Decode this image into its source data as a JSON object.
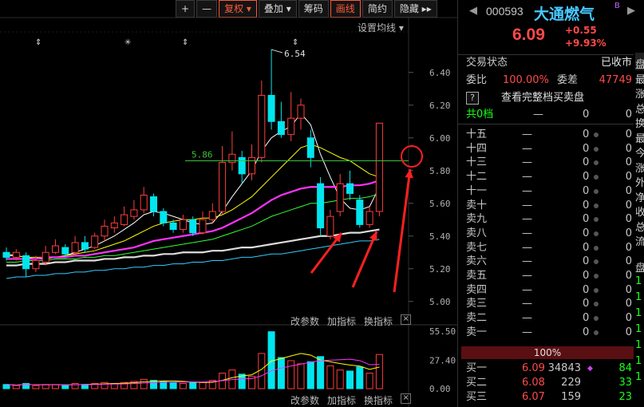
{
  "toolbar": {
    "plus": "+",
    "minus": "—",
    "fuquan": "复权",
    "diejia": "叠加",
    "choumа": "筹码",
    "huaxian": "画线",
    "jianyue": "简约",
    "yincang": "隐藏",
    "more": "▸▸",
    "avg_settings": "设置均线"
  },
  "chart": {
    "y_ticks": [
      "6.40",
      "6.20",
      "6.00",
      "5.80",
      "5.60",
      "5.40",
      "5.20",
      "5.00"
    ],
    "high_label": "6.54",
    "ref_label": "5.86",
    "vol_ticks": [
      "55.50",
      "27.40",
      "0.00"
    ],
    "ind_buttons": [
      "改参数",
      "加指标",
      "换指标"
    ],
    "close_x": "×"
  },
  "chart_data": {
    "type": "candlestick",
    "y_range": [
      4.95,
      6.55
    ],
    "candles": [
      {
        "o": 5.3,
        "c": 5.27,
        "h": 5.33,
        "l": 5.25,
        "v": 4
      },
      {
        "o": 5.27,
        "c": 5.3,
        "h": 5.32,
        "l": 5.25,
        "v": 3
      },
      {
        "o": 5.28,
        "c": 5.2,
        "h": 5.3,
        "l": 5.15,
        "v": 5
      },
      {
        "o": 5.2,
        "c": 5.25,
        "h": 5.28,
        "l": 5.18,
        "v": 3
      },
      {
        "o": 5.24,
        "c": 5.3,
        "h": 5.34,
        "l": 5.22,
        "v": 4
      },
      {
        "o": 5.3,
        "c": 5.34,
        "h": 5.38,
        "l": 5.29,
        "v": 4
      },
      {
        "o": 5.33,
        "c": 5.29,
        "h": 5.35,
        "l": 5.27,
        "v": 3
      },
      {
        "o": 5.3,
        "c": 5.36,
        "h": 5.4,
        "l": 5.28,
        "v": 5
      },
      {
        "o": 5.36,
        "c": 5.32,
        "h": 5.4,
        "l": 5.3,
        "v": 4
      },
      {
        "o": 5.33,
        "c": 5.4,
        "h": 5.42,
        "l": 5.32,
        "v": 5
      },
      {
        "o": 5.4,
        "c": 5.46,
        "h": 5.5,
        "l": 5.37,
        "v": 6
      },
      {
        "o": 5.45,
        "c": 5.48,
        "h": 5.52,
        "l": 5.42,
        "v": 5
      },
      {
        "o": 5.47,
        "c": 5.53,
        "h": 5.58,
        "l": 5.46,
        "v": 6
      },
      {
        "o": 5.52,
        "c": 5.56,
        "h": 5.62,
        "l": 5.5,
        "v": 7
      },
      {
        "o": 5.56,
        "c": 5.65,
        "h": 5.7,
        "l": 5.54,
        "v": 9
      },
      {
        "o": 5.64,
        "c": 5.55,
        "h": 5.66,
        "l": 5.52,
        "v": 8
      },
      {
        "o": 5.55,
        "c": 5.48,
        "h": 5.57,
        "l": 5.46,
        "v": 7
      },
      {
        "o": 5.48,
        "c": 5.44,
        "h": 5.5,
        "l": 5.42,
        "v": 6
      },
      {
        "o": 5.44,
        "c": 5.5,
        "h": 5.53,
        "l": 5.42,
        "v": 5
      },
      {
        "o": 5.5,
        "c": 5.42,
        "h": 5.52,
        "l": 5.4,
        "v": 6
      },
      {
        "o": 5.42,
        "c": 5.5,
        "h": 5.55,
        "l": 5.41,
        "v": 6
      },
      {
        "o": 5.5,
        "c": 5.55,
        "h": 5.6,
        "l": 5.48,
        "v": 8
      },
      {
        "o": 5.55,
        "c": 5.85,
        "h": 5.95,
        "l": 5.53,
        "v": 15
      },
      {
        "o": 5.85,
        "c": 5.9,
        "h": 6.04,
        "l": 5.8,
        "v": 18
      },
      {
        "o": 5.88,
        "c": 5.78,
        "h": 5.92,
        "l": 5.72,
        "v": 14
      },
      {
        "o": 5.78,
        "c": 5.88,
        "h": 5.96,
        "l": 5.74,
        "v": 12
      },
      {
        "o": 5.88,
        "c": 6.26,
        "h": 6.35,
        "l": 5.85,
        "v": 34
      },
      {
        "o": 6.26,
        "c": 6.1,
        "h": 6.54,
        "l": 6.05,
        "v": 55
      },
      {
        "o": 6.1,
        "c": 6.02,
        "h": 6.22,
        "l": 6.0,
        "v": 30
      },
      {
        "o": 6.02,
        "c": 6.12,
        "h": 6.28,
        "l": 5.98,
        "v": 27
      },
      {
        "o": 6.12,
        "c": 6.2,
        "h": 6.24,
        "l": 6.05,
        "v": 24
      },
      {
        "o": 6.0,
        "c": 5.88,
        "h": 6.05,
        "l": 5.82,
        "v": 26
      },
      {
        "o": 5.72,
        "c": 5.45,
        "h": 5.76,
        "l": 5.4,
        "v": 31
      },
      {
        "o": 5.4,
        "c": 5.52,
        "h": 5.56,
        "l": 5.38,
        "v": 22
      },
      {
        "o": 5.55,
        "c": 5.72,
        "h": 5.78,
        "l": 5.52,
        "v": 18
      },
      {
        "o": 5.72,
        "c": 5.66,
        "h": 5.8,
        "l": 5.62,
        "v": 17
      },
      {
        "o": 5.62,
        "c": 5.47,
        "h": 5.65,
        "l": 5.45,
        "v": 21
      },
      {
        "o": 5.47,
        "c": 5.55,
        "h": 5.58,
        "l": 5.45,
        "v": 15
      },
      {
        "o": 5.55,
        "c": 6.09,
        "h": 6.09,
        "l": 5.52,
        "v": 33
      }
    ],
    "ma_series": [
      {
        "name": "MA5",
        "color": "#ffffff",
        "values": [
          5.29,
          5.28,
          5.27,
          5.26,
          5.26,
          5.27,
          5.28,
          5.3,
          5.32,
          5.34,
          5.37,
          5.4,
          5.44,
          5.48,
          5.53,
          5.55,
          5.54,
          5.52,
          5.5,
          5.48,
          5.47,
          5.48,
          5.55,
          5.64,
          5.72,
          5.8,
          5.92,
          6.0,
          6.04,
          6.07,
          6.15,
          6.08,
          5.9,
          5.76,
          5.63,
          5.57,
          5.56,
          5.58,
          5.7
        ]
      },
      {
        "name": "MA10",
        "color": "#ffff00",
        "values": [
          5.28,
          5.28,
          5.27,
          5.27,
          5.27,
          5.27,
          5.28,
          5.29,
          5.3,
          5.31,
          5.33,
          5.35,
          5.37,
          5.4,
          5.43,
          5.46,
          5.48,
          5.49,
          5.5,
          5.5,
          5.51,
          5.51,
          5.53,
          5.56,
          5.6,
          5.64,
          5.7,
          5.76,
          5.82,
          5.88,
          5.94,
          5.96,
          5.94,
          5.91,
          5.88,
          5.86,
          5.82,
          5.78,
          5.76
        ]
      },
      {
        "name": "MA20",
        "color": "#ff33ff",
        "values": [
          5.26,
          5.26,
          5.26,
          5.26,
          5.27,
          5.27,
          5.27,
          5.28,
          5.28,
          5.29,
          5.3,
          5.31,
          5.32,
          5.33,
          5.35,
          5.37,
          5.38,
          5.39,
          5.4,
          5.41,
          5.42,
          5.43,
          5.45,
          5.48,
          5.51,
          5.54,
          5.58,
          5.62,
          5.65,
          5.67,
          5.69,
          5.7,
          5.7,
          5.7,
          5.7,
          5.71,
          5.71,
          5.72,
          5.74
        ]
      },
      {
        "name": "MA30",
        "color": "#33ff33",
        "values": [
          5.24,
          5.24,
          5.25,
          5.25,
          5.25,
          5.26,
          5.26,
          5.26,
          5.27,
          5.27,
          5.28,
          5.28,
          5.29,
          5.3,
          5.31,
          5.32,
          5.33,
          5.34,
          5.35,
          5.36,
          5.37,
          5.38,
          5.4,
          5.42,
          5.44,
          5.46,
          5.49,
          5.52,
          5.54,
          5.56,
          5.58,
          5.6,
          5.6,
          5.61,
          5.62,
          5.63,
          5.63,
          5.64,
          5.66
        ]
      },
      {
        "name": "MA60",
        "color": "#dddddd",
        "values": [
          5.22,
          5.22,
          5.23,
          5.23,
          5.23,
          5.24,
          5.24,
          5.25,
          5.25,
          5.25,
          5.26,
          5.26,
          5.27,
          5.27,
          5.28,
          5.28,
          5.29,
          5.29,
          5.3,
          5.3,
          5.3,
          5.31,
          5.31,
          5.32,
          5.33,
          5.33,
          5.34,
          5.35,
          5.36,
          5.37,
          5.38,
          5.39,
          5.4,
          5.4,
          5.41,
          5.42,
          5.42,
          5.43,
          5.44
        ]
      },
      {
        "name": "MA120",
        "color": "#33ccff",
        "values": [
          5.14,
          5.15,
          5.15,
          5.16,
          5.16,
          5.17,
          5.17,
          5.18,
          5.18,
          5.19,
          5.19,
          5.2,
          5.2,
          5.21,
          5.21,
          5.22,
          5.22,
          5.23,
          5.23,
          5.24,
          5.24,
          5.25,
          5.25,
          5.26,
          5.27,
          5.27,
          5.28,
          5.29,
          5.29,
          5.3,
          5.31,
          5.32,
          5.33,
          5.34,
          5.35,
          5.36,
          5.37,
          5.37,
          5.38
        ]
      }
    ],
    "vol_range": [
      0,
      55.5
    ]
  },
  "quote": {
    "code": "000593",
    "name": "大通燃气",
    "badge": "B",
    "price": "6.09",
    "change": "+0.55",
    "pct": "+9.93%",
    "status_label": "交易状态",
    "status_value": "已收市",
    "weibi_label": "委比",
    "weibi_value": "100.00%",
    "weicha_label": "委差",
    "weicha_value": "47749",
    "help": "?",
    "full_depth": "查看完整档买卖盘",
    "total_levels": "共0档",
    "ratio": "100%",
    "side_chars": [
      "盘",
      "最",
      "涨",
      "总",
      "换",
      "最",
      "今",
      "涨",
      "外",
      "净",
      "收",
      "总",
      "流"
    ],
    "side_bottom": [
      "盘",
      "1",
      "1",
      "1",
      "1",
      "1",
      "1",
      "1"
    ]
  },
  "asks": [
    {
      "label": "十五",
      "price": "—",
      "vol": "0",
      "n": "0"
    },
    {
      "label": "十四",
      "price": "—",
      "vol": "0",
      "n": "0"
    },
    {
      "label": "十三",
      "price": "—",
      "vol": "0",
      "n": "0"
    },
    {
      "label": "十二",
      "price": "—",
      "vol": "0",
      "n": "0"
    },
    {
      "label": "十一",
      "price": "—",
      "vol": "0",
      "n": "0"
    },
    {
      "label": "卖十",
      "price": "—",
      "vol": "0",
      "n": "0"
    },
    {
      "label": "卖九",
      "price": "—",
      "vol": "0",
      "n": "0"
    },
    {
      "label": "卖八",
      "price": "—",
      "vol": "0",
      "n": "0"
    },
    {
      "label": "卖七",
      "price": "—",
      "vol": "0",
      "n": "0"
    },
    {
      "label": "卖六",
      "price": "—",
      "vol": "0",
      "n": "0"
    },
    {
      "label": "卖五",
      "price": "—",
      "vol": "0",
      "n": "0"
    },
    {
      "label": "卖四",
      "price": "—",
      "vol": "0",
      "n": "0"
    },
    {
      "label": "卖三",
      "price": "—",
      "vol": "0",
      "n": "0"
    },
    {
      "label": "卖二",
      "price": "—",
      "vol": "0",
      "n": "0"
    },
    {
      "label": "卖一",
      "price": "—",
      "vol": "0",
      "n": "0"
    }
  ],
  "bids": [
    {
      "label": "买一",
      "price": "6.09",
      "vol": "34843",
      "n": "84"
    },
    {
      "label": "买二",
      "price": "6.08",
      "vol": "229",
      "n": "33"
    },
    {
      "label": "买三",
      "price": "6.07",
      "vol": "159",
      "n": "23"
    }
  ],
  "colors": {
    "up": "#ff3c3c",
    "down": "#00e5ee",
    "bg": "#000000",
    "accent": "#ff5a3c"
  }
}
